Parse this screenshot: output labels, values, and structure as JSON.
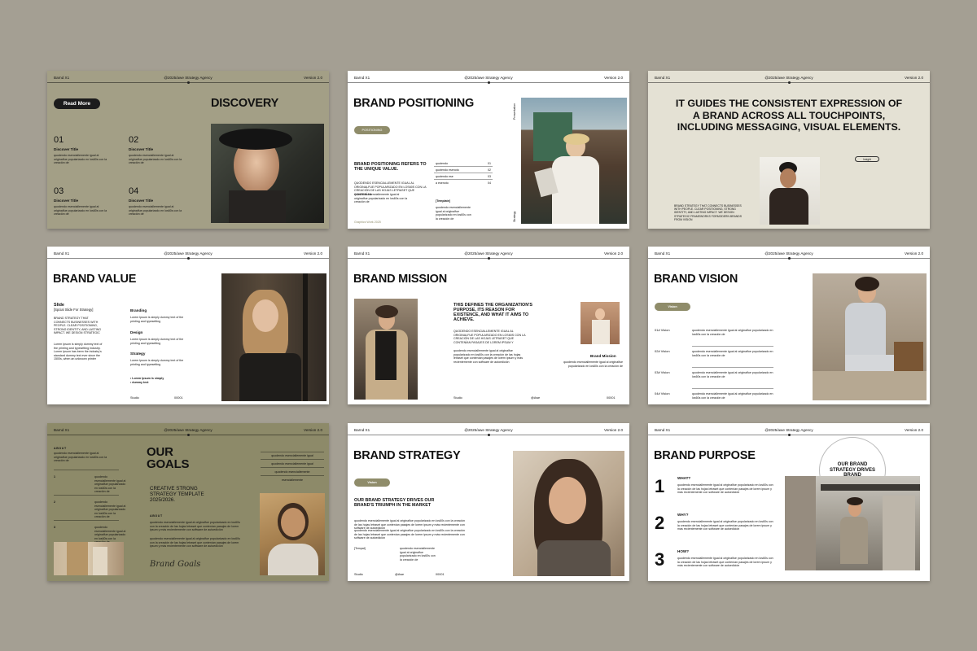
{
  "header": {
    "brand": "Barnd X1",
    "agency": "@2025/awe Strategy Agency",
    "version": "Version 2.0"
  },
  "lorem_short": "quodendo esenciallemente igual al originalfue popularizado en los60s con la creación de",
  "lorem_long": "quodendo esenciallemente igual al originalfue popularizado en los60s con la creación de las hojas letraset que contenían pasajes de lorem ipsum y más recientemente con software de autoedición",
  "slides": {
    "discovery": {
      "title": "DISCOVERY",
      "button": "Read More",
      "items": [
        {
          "num": "01",
          "title": "Discover Title"
        },
        {
          "num": "02",
          "title": "Discover Title"
        },
        {
          "num": "03",
          "title": "Discover Title"
        },
        {
          "num": "04",
          "title": "Discover Title"
        }
      ]
    },
    "positioning": {
      "title": "BRAND POSITIONING",
      "pill": "POSITIONING",
      "heading": "BRAND POSITIONING REFERS TO THE UNIQUE VALUE.",
      "body": "QUODENDO ESENCIALLEMENTE IGUAL AL ORIGINALFUE POPULARIZADO EN LOS60S CON LA CREACIÓN DE LAS HOJAS LETRASET QUE CONTENÍAN",
      "list": [
        {
          "label": "quotendo",
          "num": "01"
        },
        {
          "label": "quotendo esenoto",
          "num": "02"
        },
        {
          "label": "quotendo ese",
          "num": "03"
        },
        {
          "label": "a esenoto",
          "num": "04"
        }
      ],
      "template": "[Template]",
      "footer": "Graphics Work 2025",
      "side_top": "Presentation",
      "side_bottom": "Strategy"
    },
    "guides": {
      "heading": "IT GUIDES THE CONSISTENT EXPRESSION OF A BRAND ACROSS ALL TOUCHPOINTS, INCLUDING MESSAGING, VISUAL ELEMENTS.",
      "pill": "Insight",
      "caption": "BRAND STRATEGY THAT CONNECTS BUSINESSES WITH PEOPLE. CLEAR POSITIONING, STRONG IDENTITY, AND LASTING IMPACT. WE DESIGN STRATEGIC FRAMEWORKS FORMODERN BRANDS FROM VISION"
    },
    "value": {
      "title": "BRAND VALUE",
      "subtitle": "Slide",
      "subtitle2": "[Spcial Slide For Strategy]",
      "body": "BRAND STRATEGY THAT CONNECTS BUSINESSES WITH PEOPLE. CLEAR POSITIONING, STRONG IDENTITY, AND LASTING IMPACT. WE DESIGN STRATEGIC",
      "body2": "Lorem Ipsum is simply dummy text of the printing and typesetting industry. Lorem Ipsum has been the industry's standard dummy text ever since the 1500s, when an unknown printer",
      "items": [
        {
          "label": "Branding",
          "text": "Lorem Ipsum is simply dummy text of the printing and typesetting"
        },
        {
          "label": "Design",
          "text": "Lorem Ipsum is simply dummy text of the printing and typesetting"
        },
        {
          "label": "Strategy",
          "text": "Lorem Ipsum is simply dummy text of the printing and typesetting"
        }
      ],
      "bullets": [
        "Lorem Ipsum is simply",
        "dummy text"
      ],
      "footer_left": "Studio",
      "footer_right": "00001"
    },
    "mission": {
      "title": "BRAND MISSION",
      "heading": "THIS DEFINES THE ORGANIZATION'S PURPOSE, ITS REASON FOR EXISTENCE, AND WHAT IT AIMS TO ACHIEVE.",
      "body": "QUODENDO ESENCIALLEMENTE IGUAL AL ORIGINALFUE POPULARIZADO EN LOS60S CON LA CREACIÓN DE LAS HOJAS LETRASET QUE CONTENÍAN PASAJES DE LOREM IPSUM Y",
      "label": "Brand Mission",
      "footer_left": "Studio",
      "footer_mid": "@Awe",
      "footer_right": "00001"
    },
    "vision": {
      "title": "BRAND VISION",
      "pill": "Vision",
      "items": [
        "01# Vision",
        "02# Vision",
        "03# Vision",
        "04# Vision"
      ]
    },
    "goals": {
      "title_line1": "OUR",
      "title_line2": "GOALS",
      "about": "ABOUT",
      "about2": "ABOUT",
      "sub_line1": "CREATIVE STRONG",
      "sub_line2": "STRATEGY TEMPLATE",
      "sub_line3": "2025/2026.",
      "items": [
        {
          "num": "1"
        },
        {
          "num": "2"
        },
        {
          "num": "3"
        }
      ],
      "menu": [
        "quodendo esenciallemente igual",
        "quodendo esenciallemente igual",
        "quodendo esenciallemente",
        "esenciallemente"
      ],
      "signature": "Brand Goals"
    },
    "strategy": {
      "title": "BRAND STRATEGY",
      "pill": "Vision",
      "heading": "OUR BRAND STRATEGY DRIVES OUR BRAND'S TRIUMPH IN THE MARKET",
      "template": "[Tempat]",
      "footer_left": "Studio",
      "footer_mid": "@Awe",
      "footer_right": "00001"
    },
    "purpose": {
      "title": "BRAND PURPOSE",
      "circle": "OUR BRAND STRATEGY DRIVES BRAND",
      "items": [
        {
          "num": "1",
          "label": "WHAT?"
        },
        {
          "num": "2",
          "label": "WHY?"
        },
        {
          "num": "3",
          "label": "HOW?"
        }
      ]
    }
  }
}
